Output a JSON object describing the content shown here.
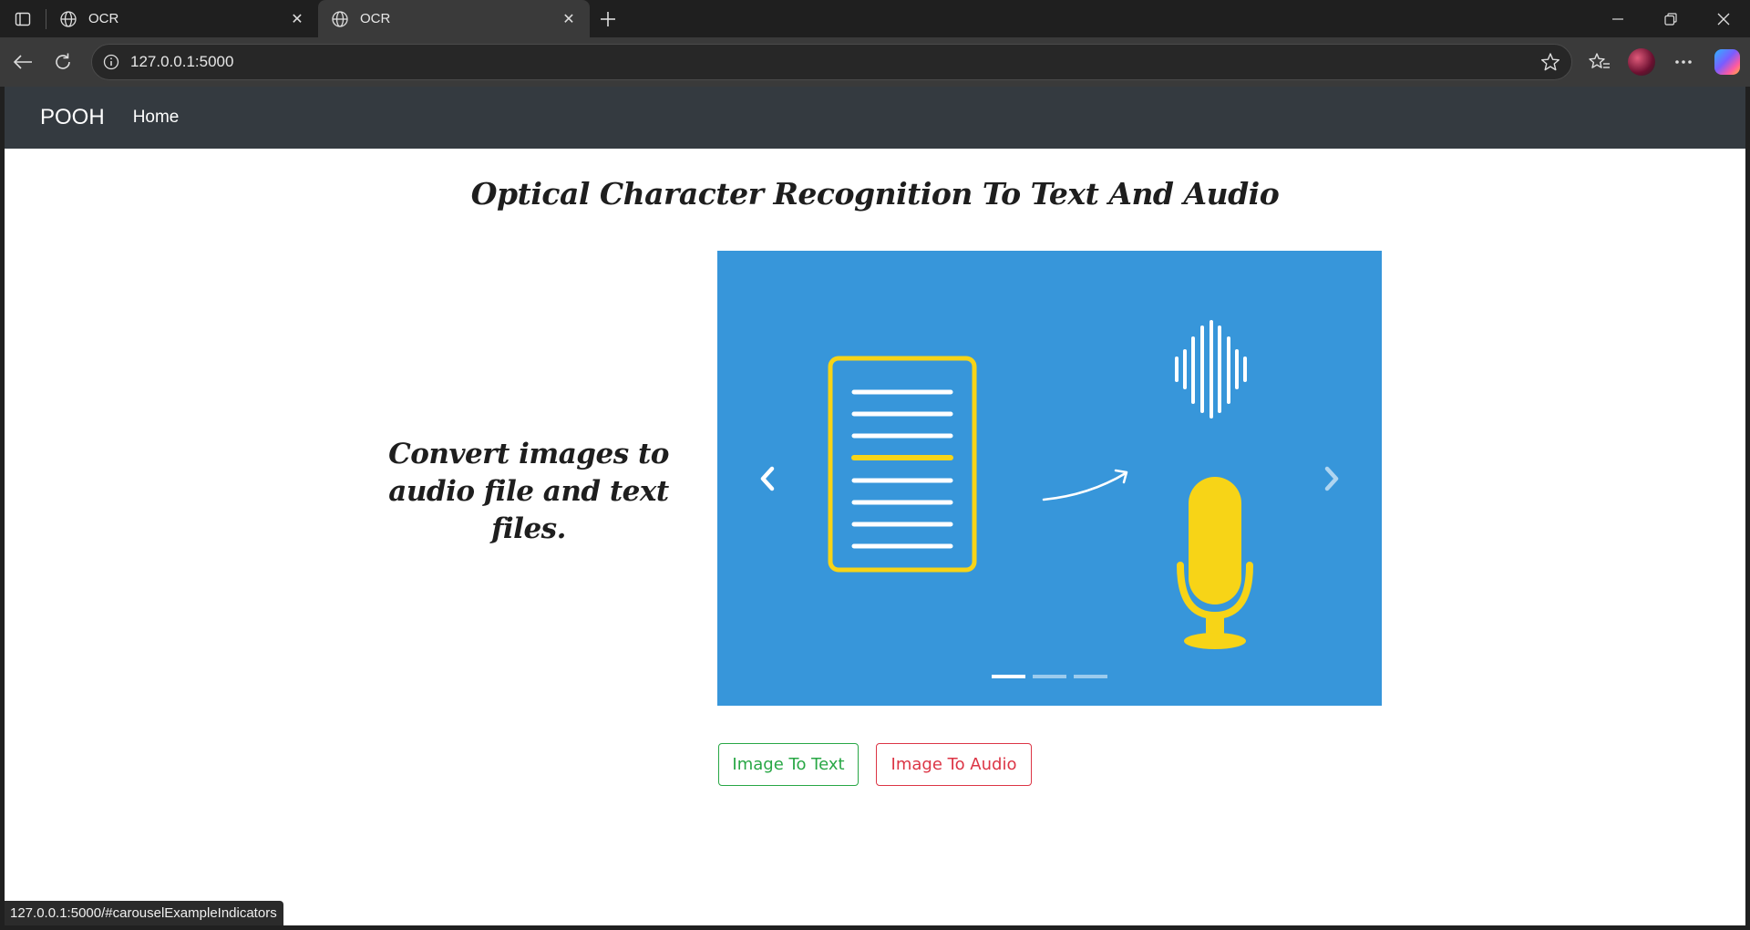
{
  "browser": {
    "tabs": [
      {
        "title": "OCR",
        "active": false
      },
      {
        "title": "OCR",
        "active": true
      }
    ],
    "address": "127.0.0.1:5000",
    "status_url": "127.0.0.1:5000/#carouselExampleIndicators"
  },
  "navbar": {
    "brand": "POOH",
    "links": [
      "Home"
    ]
  },
  "main": {
    "title": "Optical Character Recognition To Text And Audio",
    "tagline": "Convert images to audio file and text files.",
    "carousel": {
      "slides_count": 3,
      "active_index": 0,
      "background_color": "#3796da"
    },
    "buttons": {
      "image_to_text": "Image To Text",
      "image_to_audio": "Image To Audio"
    }
  },
  "colors": {
    "navbar_bg": "#343a40",
    "success": "#28a745",
    "danger": "#dc3545",
    "accent_yellow": "#f7d417"
  }
}
